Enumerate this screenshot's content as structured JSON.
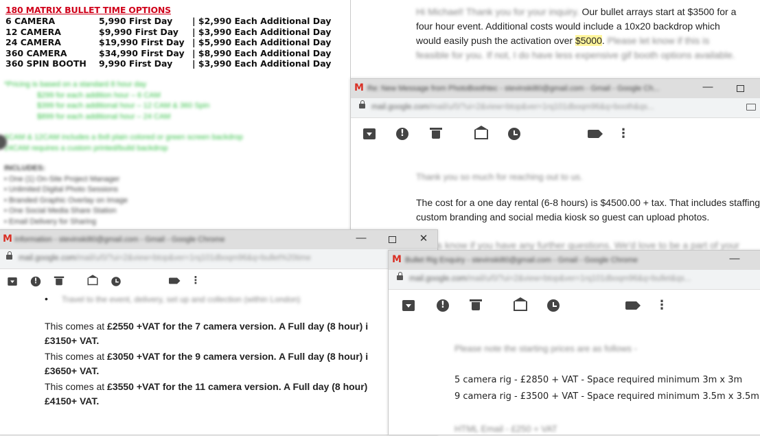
{
  "doc": {
    "title": "180 MATRIX BULLET TIME OPTIONS",
    "rows": [
      {
        "name": "6 CAMERA",
        "first": "5,990  First Day",
        "additional": "| $2,990 Each Additional Day"
      },
      {
        "name": "12 CAMERA",
        "first": "$9,990 First Day",
        "additional": "| $3,990 Each Additional Day"
      },
      {
        "name": "24 CAMERA",
        "first": "$19,990 First Day",
        "additional": "| $5,990 Each Additional Day"
      },
      {
        "name": "360 CAMERA",
        "first": "$34,990 First Day",
        "additional": "| $8,990 Each Additional Day"
      },
      {
        "name": "360 SPIN BOOTH",
        "first": "9,990 First Day",
        "additional": "| $3,990 Each Additional Day"
      }
    ],
    "green_notes": [
      "*Pricing is based on a standard 8 hour day",
      "$299 for each addition hour – 6 CAM",
      "$399 for each additional hour – 12 CAM & 360 Spin",
      "$899 for each additional hour – 24 CAM"
    ],
    "green_notes2": [
      "6CAM & 12CAM includes a 8x8 plain colored or green screen backdrop",
      "24CAM requires a custom printed/build backdrop"
    ],
    "includes_title": "INCLUDES:",
    "includes": [
      "• One (1) On-Site Project Manager",
      "• Unlimited Digital Photo Sessions",
      "• Branded Graphic Overlay on Image",
      "• One Social Media Share Station",
      "• Email Delivery for Sharing"
    ]
  },
  "top_email": {
    "line1_blur": "Hi Michael! Thank you for your inquiry.",
    "line1": " Our bullet arrays start at $3500 for a",
    "line2": "four hour event. Additional costs would include a 10x20 backdrop which",
    "line3_a": "would easily push the activation over ",
    "line3_hl": "$5000",
    "line3_b": ".",
    "line3_blur": " Please let know if this is",
    "line4_blur": "feasible for you. If not, I do have less expensive gif booth options available."
  },
  "win1": {
    "title": "Re: New Message from PhotoBoothtec - stevinski80@gmail.com - Gmail - Google Ch...",
    "url_host": "mail.google.com",
    "url_path": "/mail/u/0/?ui=2&view=btop&ver=1rq101dboqm96&q=booth&qs...",
    "body_blur1": "Thank you so much for reaching out to us.",
    "body_line1": "The cost for a one day rental (6-8 hours) is $4500.00 + tax. That includes staffing,",
    "body_line2": "custom branding and social media kiosk so guest can upload photos.",
    "body_blur2": "Let us know if you have any further questions. We'd love to be a part of your"
  },
  "win2": {
    "title": "Information - stevinski80@gmail.com - Gmail - Google Chrome",
    "url_host": "mail.google.com",
    "url_path": "/mail/u/0/?ui=2&view=btop&ver=1rq101dboqm96&q=bullet%20time",
    "bullet_blur": "Travel to the event, delivery, set up and collection (within London)",
    "lines": [
      {
        "pre": "This comes at ",
        "price": "£2550 +VAT for the 7 camera version. A Full day (8 hour) i",
        "next": "£3150+ VAT."
      },
      {
        "pre": "This comes at ",
        "price": "£3050 +VAT for the 9 camera version. A Full day (8 hour) i",
        "next": "£3650+ VAT."
      },
      {
        "pre": "This comes at ",
        "price": "£3550 +VAT for the 11 camera version. A Full day (8 hour)",
        "next": "£4150+ VAT."
      }
    ]
  },
  "win3": {
    "title": "Bullet Rig Enquiry - stevinski80@gmail.com - Gmail - Google Chrome",
    "url_host": "mail.google.com",
    "url_path": "/mail/u/0/?ui=2&view=btop&ver=1rq101dboqm96&q=bullet&qs...",
    "intro_blur": "Please note the starting prices are as follows -",
    "line1": "5 camera rig - £2850 + VAT - Space required minimum 3m x 3m",
    "line2": "9 camera rig - £3500 + VAT - Space required minimum 3.5m x 3.5m",
    "line3_blur": "HTML Email - £250 + VAT"
  },
  "window_controls": {
    "minimize": "—",
    "close": "✕"
  },
  "gmail_logo": "M",
  "more_glyph": "⋮"
}
